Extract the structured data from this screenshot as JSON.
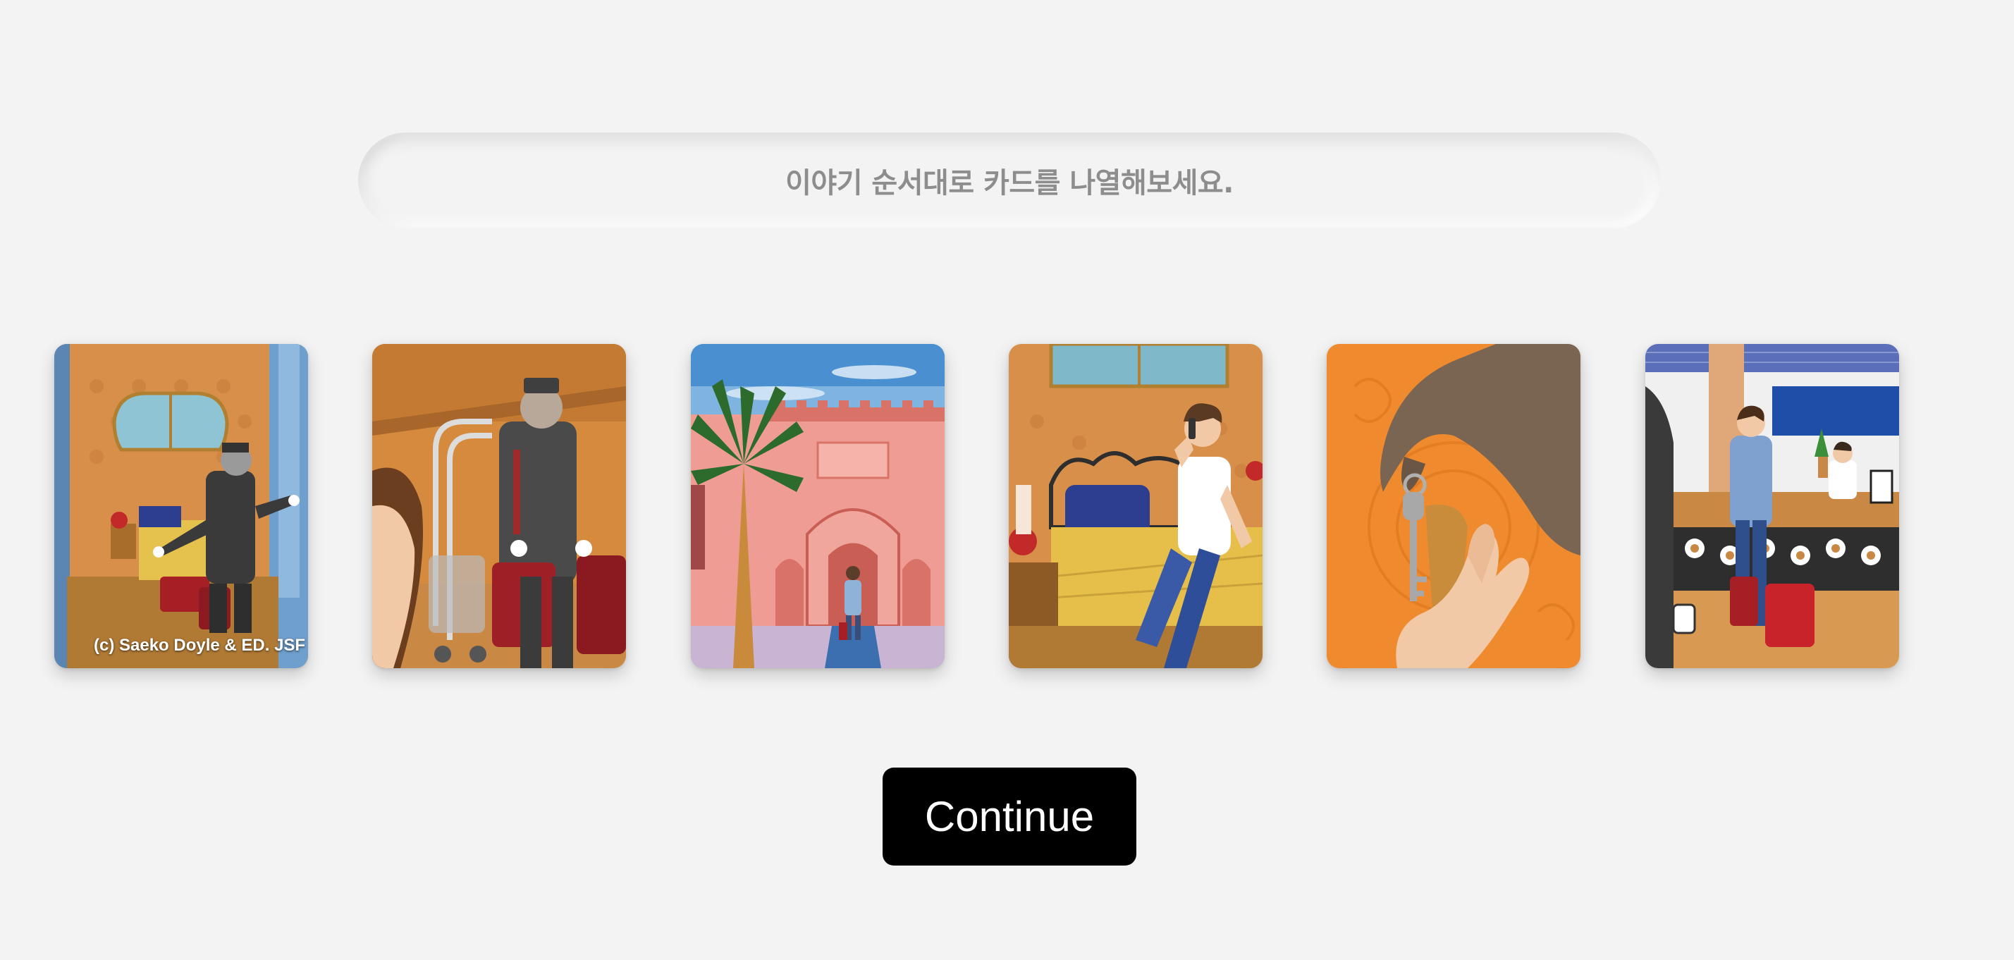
{
  "instruction": {
    "text": "이야기 순서대로 카드를 나열해보세요."
  },
  "cards": [
    {
      "name": "bellboy-opening-hotel-room",
      "credit": "(c) Saeko Doyle & ED. JSF"
    },
    {
      "name": "bellboy-carrying-luggage"
    },
    {
      "name": "hotel-entrance"
    },
    {
      "name": "guest-on-phone-in-room"
    },
    {
      "name": "handing-over-room-key"
    },
    {
      "name": "hotel-front-desk-check-in"
    }
  ],
  "actions": {
    "continue_label": "Continue"
  },
  "colors": {
    "background": "#f3f3f3",
    "instruction_text": "#8d8d8d",
    "button_background": "#000000",
    "button_text": "#ffffff"
  }
}
